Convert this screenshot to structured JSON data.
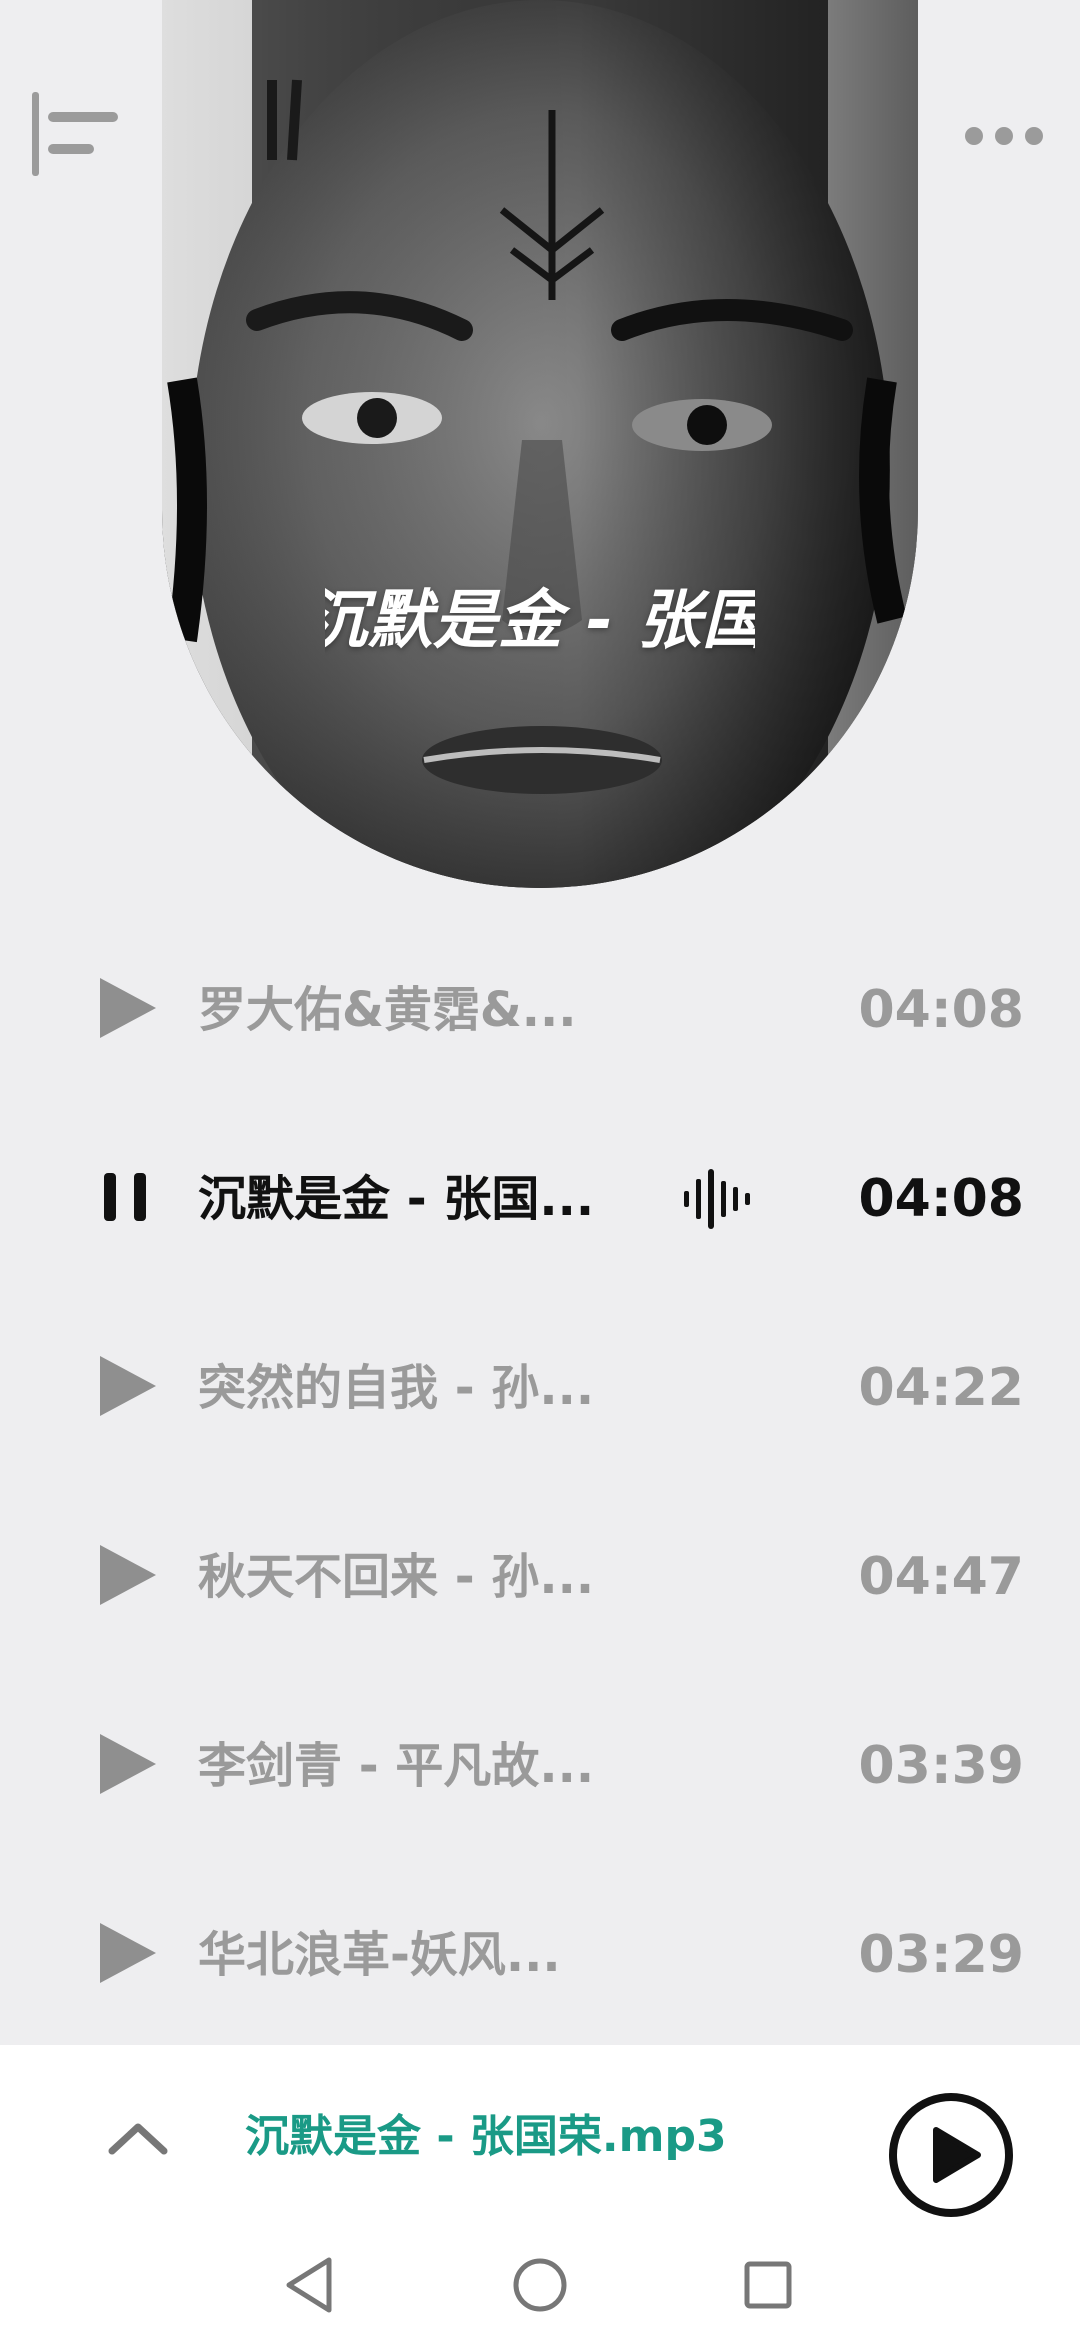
{
  "header": {
    "menu_icon": "menu-align-left-icon",
    "more_icon": "more-horizontal-icon"
  },
  "album": {
    "overlay_title": "沉默是金 - 张国荣"
  },
  "playlist": [
    {
      "title": "罗大佑&黄霑&...",
      "duration": "04:08",
      "state": "play"
    },
    {
      "title": "沉默是金 - 张国...",
      "duration": "04:08",
      "state": "pause"
    },
    {
      "title": "突然的自我 - 孙...",
      "duration": "04:22",
      "state": "play"
    },
    {
      "title": "秋天不回来 - 孙...",
      "duration": "04:47",
      "state": "play"
    },
    {
      "title": "李剑青 - 平凡故...",
      "duration": "03:39",
      "state": "play"
    },
    {
      "title": "华北浪革-妖风...",
      "duration": "03:29",
      "state": "play"
    }
  ],
  "now_playing": {
    "title": "沉默是金 - 张国荣.mp3",
    "accent_color": "#1a9a86"
  },
  "colors": {
    "background": "#eeeef0",
    "inactive_text": "#9a9a9a",
    "active_text": "#111111"
  }
}
